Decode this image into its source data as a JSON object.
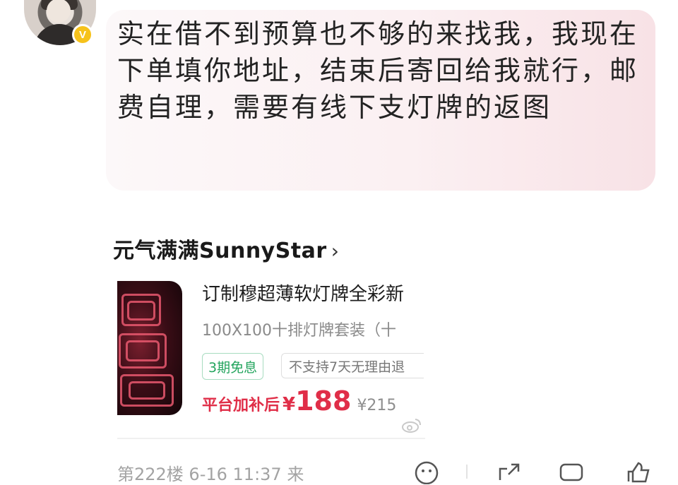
{
  "comment": {
    "message": "实在借不到预算也不够的来找我，我现在下单填你地址，结束后寄回给我就行，邮费自理，需要有线下支灯牌的返图",
    "verified_badge": "V"
  },
  "product_card": {
    "shop_name": "元气满满SunnyStar",
    "shop_chevron": "›",
    "title": "订制穆超薄软灯牌全彩新",
    "subtitle": "100X100十排灯牌套装（十",
    "tag_installment": "3期免息",
    "tag_return": "不支持7天无理由退",
    "price_label": "平台加补后",
    "currency": "¥",
    "price": "188",
    "original_price": "¥215"
  },
  "footer": {
    "meta": "第222楼  6-16 11:37  来"
  },
  "icons": {
    "verified": "verified-v-icon",
    "chevron": "chevron-right-icon",
    "watermark": "weibo-watermark-icon",
    "emoji": "emoji-icon",
    "share": "share-icon",
    "comment": "comment-icon",
    "like": "like-icon"
  },
  "colors": {
    "price_red": "#e02e48",
    "tag_green": "#23a45d",
    "badge_yellow": "#f6c21b"
  }
}
